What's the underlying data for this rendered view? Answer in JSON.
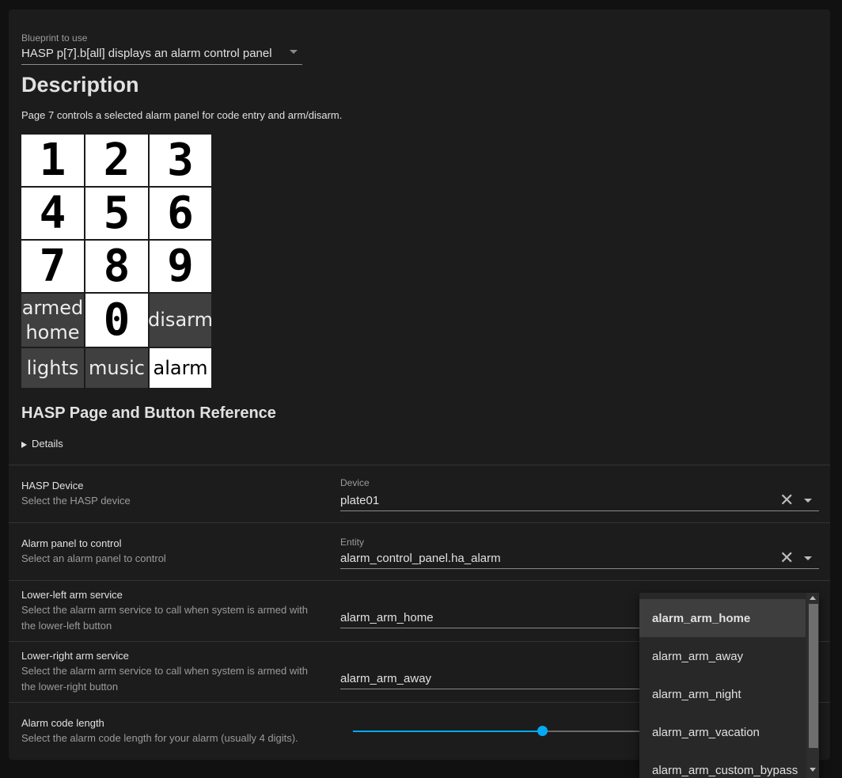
{
  "blueprint": {
    "label": "Blueprint to use",
    "value": "HASP p[7].b[all] displays an alarm control panel"
  },
  "description": {
    "heading": "Description",
    "text": "Page 7 controls a selected alarm panel for code entry and arm/disarm."
  },
  "keypad": {
    "keys": [
      {
        "label": "1"
      },
      {
        "label": "2"
      },
      {
        "label": "3"
      },
      {
        "label": "4"
      },
      {
        "label": "5"
      },
      {
        "label": "6"
      },
      {
        "label": "7"
      },
      {
        "label": "8"
      },
      {
        "label": "9"
      },
      {
        "label": "armed\nhome"
      },
      {
        "label": "0"
      },
      {
        "label": "disarm"
      },
      {
        "label": "lights"
      },
      {
        "label": "music"
      },
      {
        "label": "alarm"
      }
    ]
  },
  "reference": {
    "heading": "HASP Page and Button Reference",
    "details_label": "Details"
  },
  "inputs": {
    "hasp_device": {
      "title": "HASP Device",
      "description": "Select the HASP device",
      "field_label": "Device",
      "value": "plate01"
    },
    "alarm_panel": {
      "title": "Alarm panel to control",
      "description": "Select an alarm panel to control",
      "field_label": "Entity",
      "value": "alarm_control_panel.ha_alarm"
    },
    "lower_left": {
      "title": "Lower-left arm service",
      "description": "Select the alarm arm service to call when system is armed with the lower-left button",
      "value": "alarm_arm_home"
    },
    "lower_right": {
      "title": "Lower-right arm service",
      "description": "Select the alarm arm service to call when system is armed with the lower-right button",
      "value": "alarm_arm_away"
    },
    "code_length": {
      "title": "Alarm code length",
      "description": "Select the alarm code length for your alarm (usually 4 digits).",
      "slider_fraction": 0.66
    }
  },
  "dropdown": {
    "options": [
      {
        "label": "alarm_arm_home",
        "selected": true
      },
      {
        "label": "alarm_arm_away",
        "selected": false
      },
      {
        "label": "alarm_arm_night",
        "selected": false
      },
      {
        "label": "alarm_arm_vacation",
        "selected": false
      },
      {
        "label": "alarm_arm_custom_bypass",
        "selected": false
      }
    ]
  },
  "colors": {
    "accent": "#03a9f4",
    "card_background": "#1c1c1c",
    "page_background": "#111111"
  }
}
